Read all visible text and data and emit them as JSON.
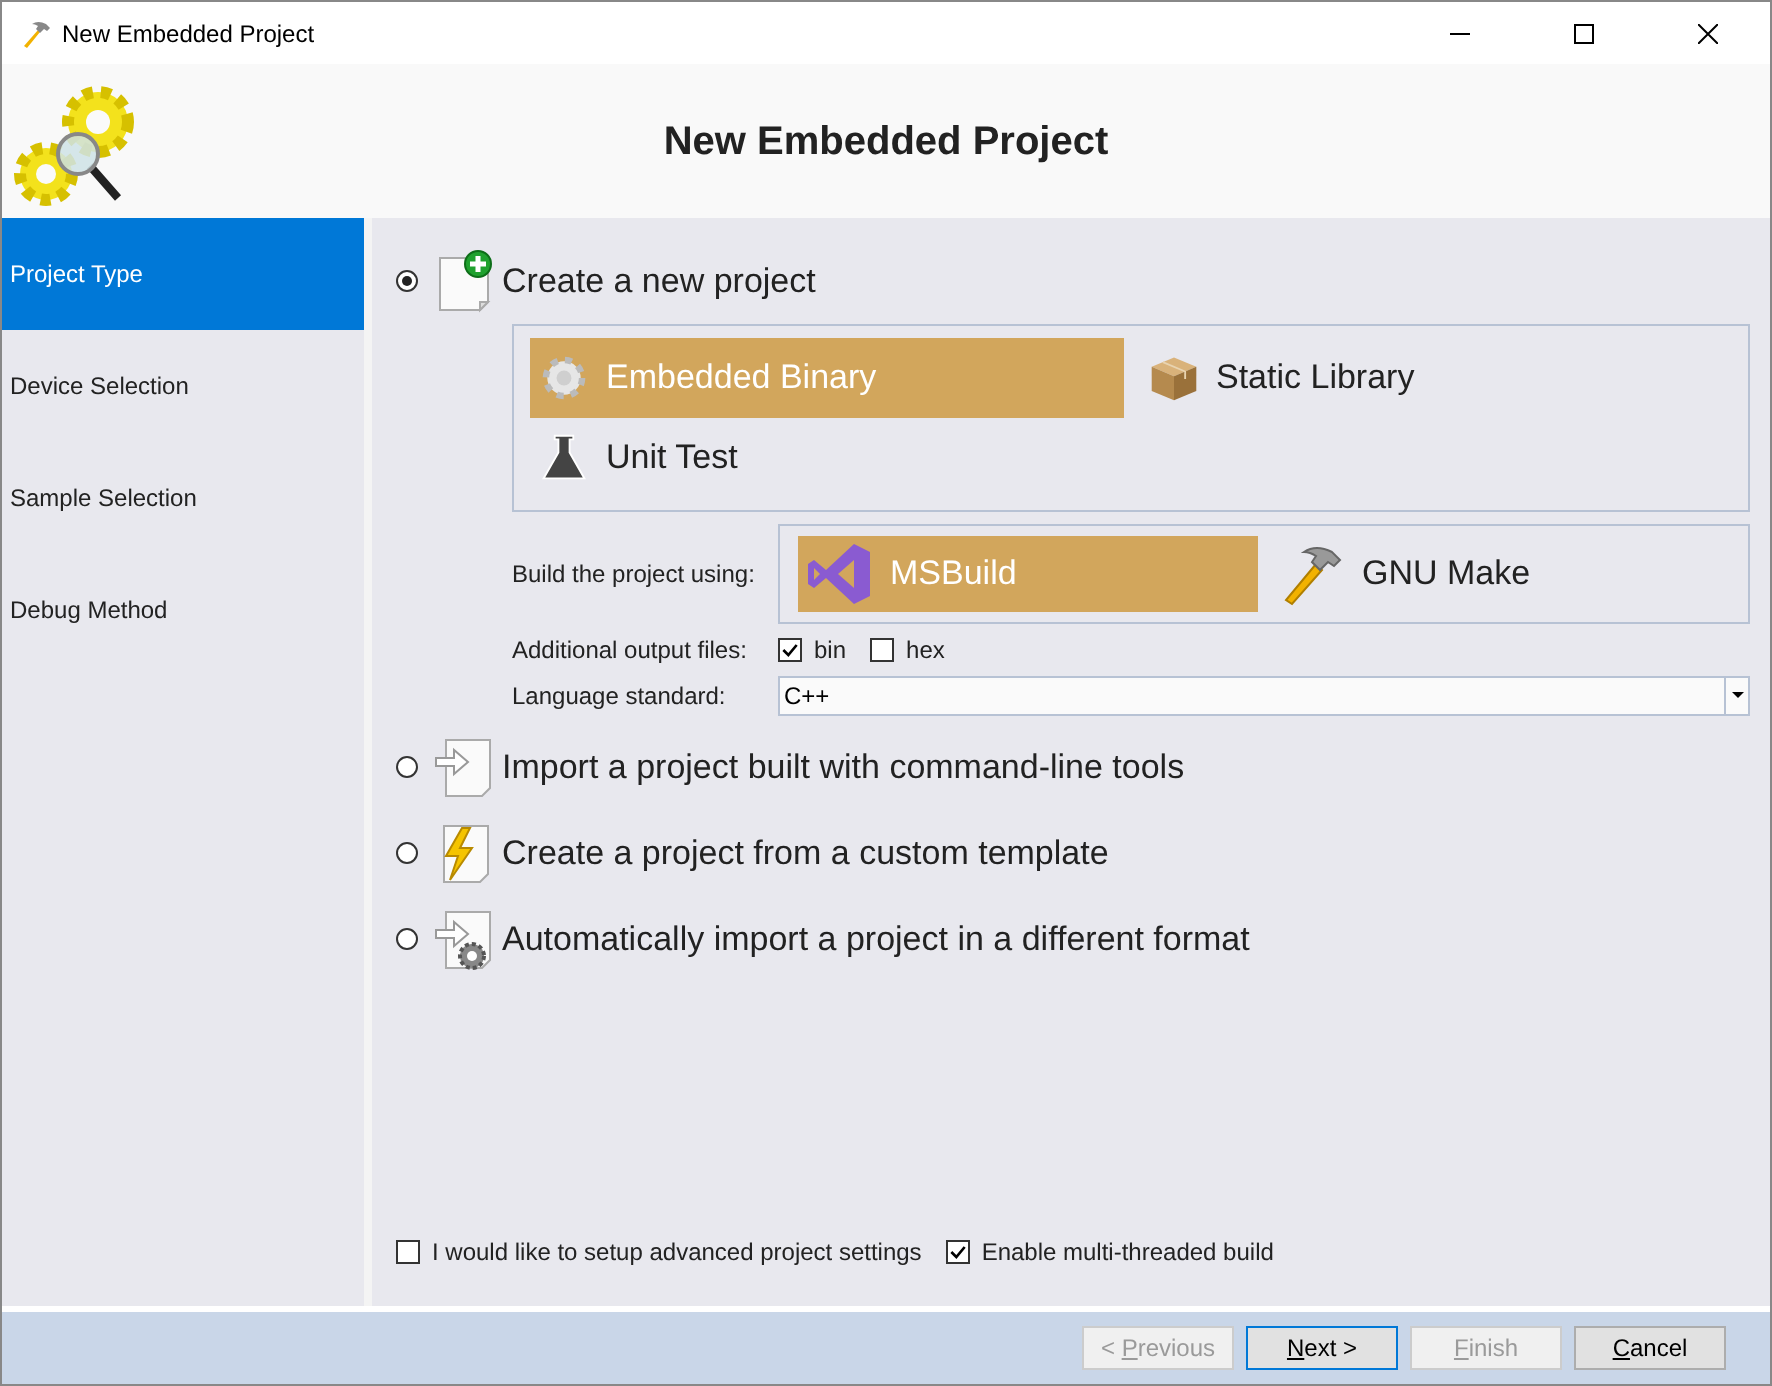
{
  "window": {
    "title": "New Embedded Project"
  },
  "header": {
    "title": "New Embedded Project"
  },
  "sidebar": {
    "items": [
      {
        "label": "Project Type",
        "selected": true
      },
      {
        "label": "Device Selection",
        "selected": false
      },
      {
        "label": "Sample Selection",
        "selected": false
      },
      {
        "label": "Debug Method",
        "selected": false
      }
    ]
  },
  "options": [
    {
      "label": "Create a new project",
      "selected": true,
      "kind": "new"
    },
    {
      "label": "Import a project built with command-line tools",
      "selected": false,
      "kind": "import"
    },
    {
      "label": "Create a project from a custom template",
      "selected": false,
      "kind": "template"
    },
    {
      "label": "Automatically import a project in a different format",
      "selected": false,
      "kind": "auto"
    }
  ],
  "project_types": [
    {
      "label": "Embedded Binary",
      "selected": true,
      "kind": "gear"
    },
    {
      "label": "Static Library",
      "selected": false,
      "kind": "box"
    },
    {
      "label": "Unit Test",
      "selected": false,
      "kind": "flask"
    }
  ],
  "build": {
    "label": "Build the project using:",
    "systems": [
      {
        "label": "MSBuild",
        "selected": true,
        "kind": "vs"
      },
      {
        "label": "GNU Make",
        "selected": false,
        "kind": "hammer"
      }
    ]
  },
  "output_files": {
    "label": "Additional output files:",
    "options": [
      {
        "label": "bin",
        "checked": true
      },
      {
        "label": "hex",
        "checked": false
      }
    ]
  },
  "language": {
    "label": "Language standard:",
    "value": "C++"
  },
  "footer_checks": [
    {
      "label": "I would like to setup advanced project settings",
      "checked": false
    },
    {
      "label": "Enable multi-threaded build",
      "checked": true
    }
  ],
  "buttons": [
    {
      "before": "< ",
      "key": "P",
      "after": "revious",
      "disabled": true,
      "default": false
    },
    {
      "key": "N",
      "after": "ext >",
      "disabled": false,
      "default": true
    },
    {
      "key": "F",
      "after": "inish",
      "disabled": true,
      "default": false
    },
    {
      "key": "C",
      "after": "ancel",
      "disabled": false,
      "default": false
    }
  ]
}
